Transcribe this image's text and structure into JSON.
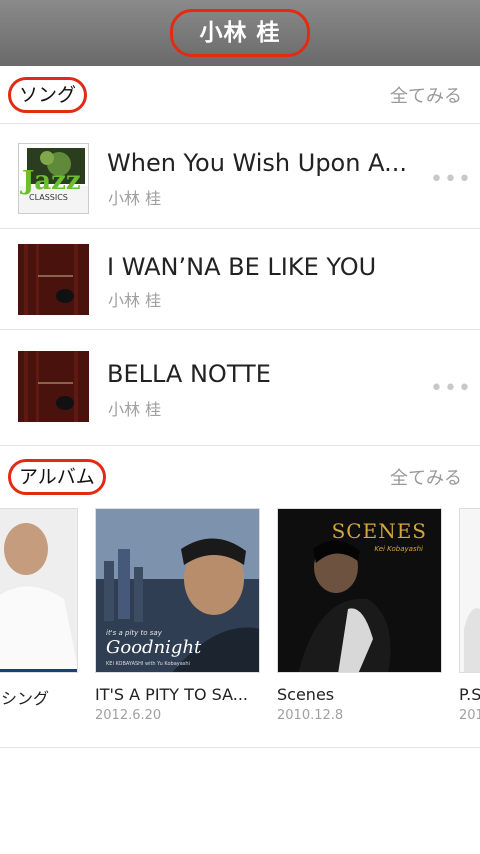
{
  "header": {
    "title": "小林 桂"
  },
  "songs_section": {
    "title": "ソング",
    "see_all": "全てみる",
    "items": [
      {
        "title": "When You Wish Upon A...",
        "artist": "小林 桂",
        "cover_text": "Jazz",
        "cover_sub": "CLASSICS"
      },
      {
        "title": "I WAN’NA BE LIKE YOU",
        "artist": "小林 桂"
      },
      {
        "title": "BELLA NOTTE",
        "artist": "小林 桂"
      }
    ],
    "more_label": "•••"
  },
  "albums_section": {
    "title": "アルバム",
    "see_all": "全てみる",
    "items": [
      {
        "title": "シング",
        "date": ""
      },
      {
        "title": "IT'S A PITY TO SA...",
        "date": "2012.6.20",
        "cover_line1": "it's a pity to say",
        "cover_line2": "Goodnight",
        "cover_line3": "KEI KOBAYASHI with Yu Kobayashi"
      },
      {
        "title": "Scenes",
        "date": "2010.12.8",
        "cover_line1": "SCENES",
        "cover_line2": "Kei Kobayashi"
      },
      {
        "title": "P.S",
        "date": "201"
      }
    ]
  },
  "colors": {
    "annotation": "#e32a12",
    "header": "#777777",
    "muted": "#a0a0a0"
  }
}
